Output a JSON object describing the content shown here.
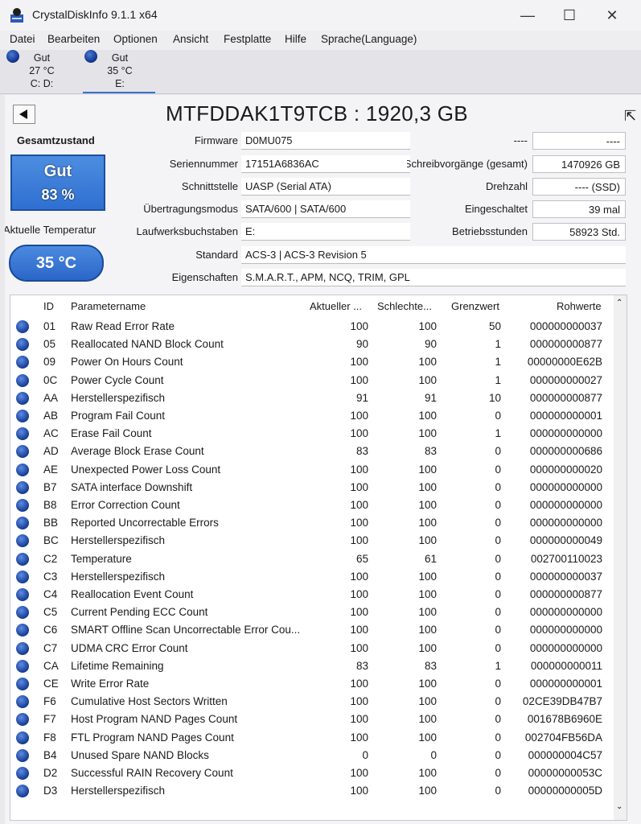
{
  "window": {
    "title": "CrystalDiskInfo 9.1.1 x64",
    "minimize": "—",
    "maximize": "☐",
    "close": "✕"
  },
  "menu": [
    "Datei",
    "Bearbeiten",
    "Optionen",
    "Ansicht",
    "Festplatte",
    "Hilfe",
    "Sprache(Language)"
  ],
  "drives": [
    {
      "status": "Gut",
      "temp": "27 °C",
      "letters": "C: D:"
    },
    {
      "status": "Gut",
      "temp": "35 °C",
      "letters": "E:"
    }
  ],
  "disk": {
    "title": "MTFDDAK1T9TCB : 1920,3 GB",
    "health_label": "Gesamtzustand",
    "health_status": "Gut",
    "health_percent": "83 %",
    "health_color": "#3a7bd5",
    "temp_label": "Aktuelle Temperatur",
    "temp_value": "35 °C"
  },
  "fields": {
    "firmware": {
      "label": "Firmware",
      "value": "D0MU075"
    },
    "serial": {
      "label": "Seriennummer",
      "value": "17151A6836AC"
    },
    "interface": {
      "label": "Schnittstelle",
      "value": "UASP (Serial ATA)"
    },
    "transfer": {
      "label": "Übertragungsmodus",
      "value": "SATA/600 | SATA/600"
    },
    "letters": {
      "label": "Laufwerksbuchstaben",
      "value": "E:"
    },
    "standard": {
      "label": "Standard",
      "value": "ACS-3 | ACS-3 Revision 5"
    },
    "features": {
      "label": "Eigenschaften",
      "value": "S.M.A.R.T., APM, NCQ, TRIM, GPL"
    }
  },
  "right_fields": {
    "r1": {
      "label": "----",
      "value": "----"
    },
    "writes": {
      "label": "Schreibvorgänge (gesamt)",
      "value": "1470926 GB"
    },
    "rpm": {
      "label": "Drehzahl",
      "value": "---- (SSD)"
    },
    "power_on_count": {
      "label": "Eingeschaltet",
      "value": "39 mal"
    },
    "power_on_hours": {
      "label": "Betriebsstunden",
      "value": "58923 Std."
    }
  },
  "table": {
    "headers": {
      "id": "ID",
      "name": "Parametername",
      "current": "Aktueller ...",
      "worst": "Schlechte...",
      "threshold": "Grenzwert",
      "raw": "Rohwerte"
    },
    "rows": [
      [
        "01",
        "Raw Read Error Rate",
        "100",
        "100",
        "50",
        "000000000037"
      ],
      [
        "05",
        "Reallocated NAND Block Count",
        "90",
        "90",
        "1",
        "000000000877"
      ],
      [
        "09",
        "Power On Hours Count",
        "100",
        "100",
        "1",
        "00000000E62B"
      ],
      [
        "0C",
        "Power Cycle Count",
        "100",
        "100",
        "1",
        "000000000027"
      ],
      [
        "AA",
        "Herstellerspezifisch",
        "91",
        "91",
        "10",
        "000000000877"
      ],
      [
        "AB",
        "Program Fail Count",
        "100",
        "100",
        "0",
        "000000000001"
      ],
      [
        "AC",
        "Erase Fail Count",
        "100",
        "100",
        "1",
        "000000000000"
      ],
      [
        "AD",
        "Average Block Erase Count",
        "83",
        "83",
        "0",
        "000000000686"
      ],
      [
        "AE",
        "Unexpected Power Loss Count",
        "100",
        "100",
        "0",
        "000000000020"
      ],
      [
        "B7",
        "SATA interface Downshift",
        "100",
        "100",
        "0",
        "000000000000"
      ],
      [
        "B8",
        "Error Correction Count",
        "100",
        "100",
        "0",
        "000000000000"
      ],
      [
        "BB",
        "Reported Uncorrectable Errors",
        "100",
        "100",
        "0",
        "000000000000"
      ],
      [
        "BC",
        "Herstellerspezifisch",
        "100",
        "100",
        "0",
        "000000000049"
      ],
      [
        "C2",
        "Temperature",
        "65",
        "61",
        "0",
        "002700110023"
      ],
      [
        "C3",
        "Herstellerspezifisch",
        "100",
        "100",
        "0",
        "000000000037"
      ],
      [
        "C4",
        "Reallocation Event Count",
        "100",
        "100",
        "0",
        "000000000877"
      ],
      [
        "C5",
        "Current Pending ECC Count",
        "100",
        "100",
        "0",
        "000000000000"
      ],
      [
        "C6",
        "SMART Offline Scan Uncorrectable Error Cou...",
        "100",
        "100",
        "0",
        "000000000000"
      ],
      [
        "C7",
        "UDMA CRC Error Count",
        "100",
        "100",
        "0",
        "000000000000"
      ],
      [
        "CA",
        "Lifetime Remaining",
        "83",
        "83",
        "1",
        "000000000011"
      ],
      [
        "CE",
        "Write Error Rate",
        "100",
        "100",
        "0",
        "000000000001"
      ],
      [
        "F6",
        "Cumulative Host Sectors Written",
        "100",
        "100",
        "0",
        "02CE39DB47B7"
      ],
      [
        "F7",
        "Host Program NAND Pages Count",
        "100",
        "100",
        "0",
        "001678B6960E"
      ],
      [
        "F8",
        "FTL Program NAND Pages Count",
        "100",
        "100",
        "0",
        "002704FB56DA"
      ],
      [
        "B4",
        "Unused Spare NAND Blocks",
        "0",
        "0",
        "0",
        "000000004C57"
      ],
      [
        "D2",
        "Successful RAIN Recovery Count",
        "100",
        "100",
        "0",
        "00000000053C"
      ],
      [
        "D3",
        "Herstellerspezifisch",
        "100",
        "100",
        "0",
        "00000000005D"
      ]
    ]
  }
}
